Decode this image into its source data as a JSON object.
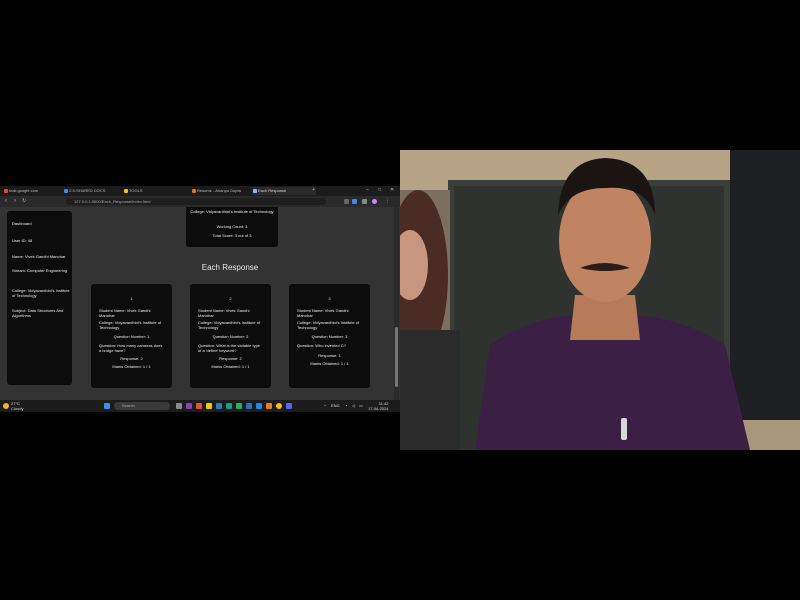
{
  "browser": {
    "tabs": [
      {
        "label": "mail.google.com",
        "color": "#ea4335"
      },
      {
        "label": "2-9-SHARED DOCS",
        "color": "#4285f4"
      },
      {
        "label": "TOOLS",
        "color": "#fbbc05"
      },
      {
        "label": "Resume - Ananya Gupta",
        "color": "#e8710a"
      },
      {
        "label": "Each Response",
        "color": "#8ab4f8",
        "active": true
      }
    ],
    "url": "127.0.0.1:5500/Each_Response/index.html"
  },
  "sidebar": {
    "lines": [
      "Dashboard",
      "User ID: 48",
      "Name: Vivek Gandhi Manohar",
      "Stream: Computer Engineering",
      "College: Vidyavardhini's Institute of Technology",
      "Subject: Data Structures And Algorithms"
    ]
  },
  "summary": {
    "lines": [
      "College: Vidyavardhini's Institute of Technology",
      "Working Count: 3",
      "Total Score: 3 out of 3"
    ]
  },
  "section_title": "Each Response",
  "responses": [
    {
      "number": "1",
      "name": "Student Name: Vivek Gandhi Manohar",
      "college": "College: Vidyavardhini's Institute of Technology",
      "question_num": "Question Number: 1",
      "question": "Question: How many cameras does a bridge have?",
      "response": "Response: 2",
      "marks": "Marks Obtained: 1 / 1"
    },
    {
      "number": "2",
      "name": "Student Name: Vivek Gandhi Manohar",
      "college": "College: Vidyavardhini's Institute of Technology",
      "question_num": "Question Number: 2",
      "question": "Question: What is the variable type of a 'define' keyword?",
      "response": "Response: 2",
      "marks": "Marks Obtained: 1 / 1"
    },
    {
      "number": "3",
      "name": "Student Name: Vivek Gandhi Manohar",
      "college": "College: Vidyavardhini's Institute of Technology",
      "question_num": "Question Number: 3",
      "question": "Question: Who invented C?",
      "response": "Response: 1",
      "marks": "Marks Obtained: 1 / 1"
    }
  ],
  "taskbar": {
    "weather_temp": "27°C",
    "weather_desc": "Cloudy",
    "search_placeholder": "Search",
    "time": "11:42",
    "date": "17-04-2024",
    "lang": "ENG"
  }
}
